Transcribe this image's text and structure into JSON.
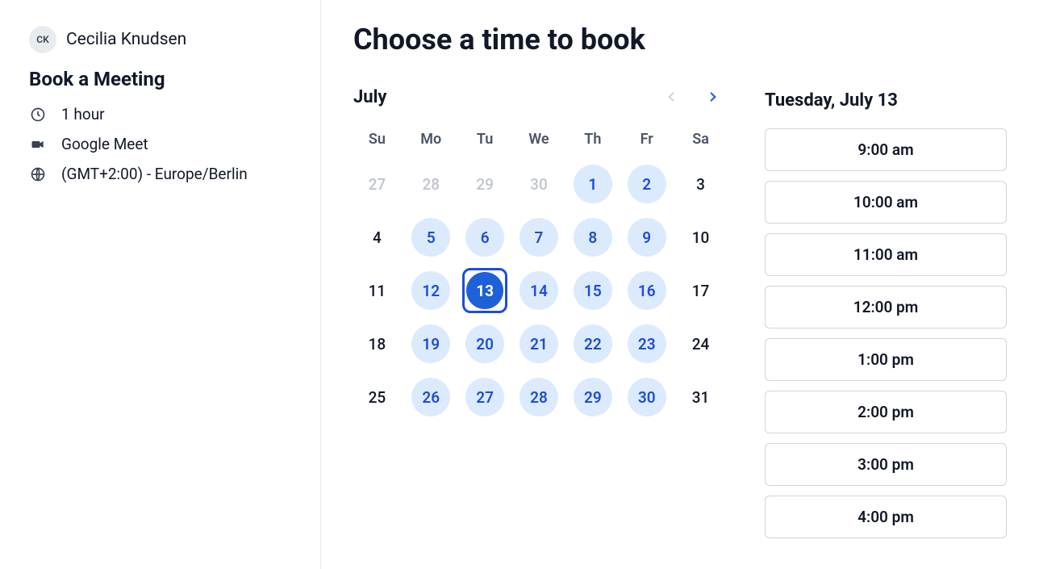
{
  "host": {
    "initials": "CK",
    "name": "Cecilia Knudsen"
  },
  "sidebar": {
    "title": "Book a Meeting",
    "duration": "1 hour",
    "location": "Google Meet",
    "timezone": "(GMT+2:00) - Europe/Berlin"
  },
  "main": {
    "title": "Choose a time to book"
  },
  "calendar": {
    "month_label": "July",
    "dow": [
      "Su",
      "Mo",
      "Tu",
      "We",
      "Th",
      "Fr",
      "Sa"
    ],
    "prev_enabled": false,
    "next_enabled": true,
    "weeks": [
      [
        {
          "n": 27,
          "state": "out"
        },
        {
          "n": 28,
          "state": "out"
        },
        {
          "n": 29,
          "state": "out"
        },
        {
          "n": 30,
          "state": "out"
        },
        {
          "n": 1,
          "state": "avail"
        },
        {
          "n": 2,
          "state": "avail"
        },
        {
          "n": 3,
          "state": "unavail"
        }
      ],
      [
        {
          "n": 4,
          "state": "unavail"
        },
        {
          "n": 5,
          "state": "avail"
        },
        {
          "n": 6,
          "state": "avail"
        },
        {
          "n": 7,
          "state": "avail"
        },
        {
          "n": 8,
          "state": "avail"
        },
        {
          "n": 9,
          "state": "avail"
        },
        {
          "n": 10,
          "state": "unavail"
        }
      ],
      [
        {
          "n": 11,
          "state": "unavail"
        },
        {
          "n": 12,
          "state": "avail"
        },
        {
          "n": 13,
          "state": "selected"
        },
        {
          "n": 14,
          "state": "avail"
        },
        {
          "n": 15,
          "state": "avail"
        },
        {
          "n": 16,
          "state": "avail"
        },
        {
          "n": 17,
          "state": "unavail"
        }
      ],
      [
        {
          "n": 18,
          "state": "unavail"
        },
        {
          "n": 19,
          "state": "avail"
        },
        {
          "n": 20,
          "state": "avail"
        },
        {
          "n": 21,
          "state": "avail"
        },
        {
          "n": 22,
          "state": "avail"
        },
        {
          "n": 23,
          "state": "avail"
        },
        {
          "n": 24,
          "state": "unavail"
        }
      ],
      [
        {
          "n": 25,
          "state": "unavail"
        },
        {
          "n": 26,
          "state": "avail"
        },
        {
          "n": 27,
          "state": "avail"
        },
        {
          "n": 28,
          "state": "avail"
        },
        {
          "n": 29,
          "state": "avail"
        },
        {
          "n": 30,
          "state": "avail"
        },
        {
          "n": 31,
          "state": "unavail"
        }
      ]
    ]
  },
  "slots": {
    "selected_date_label": "Tuesday, July 13",
    "times": [
      "9:00 am",
      "10:00 am",
      "11:00 am",
      "12:00 pm",
      "1:00 pm",
      "2:00 pm",
      "3:00 pm",
      "4:00 pm"
    ]
  }
}
